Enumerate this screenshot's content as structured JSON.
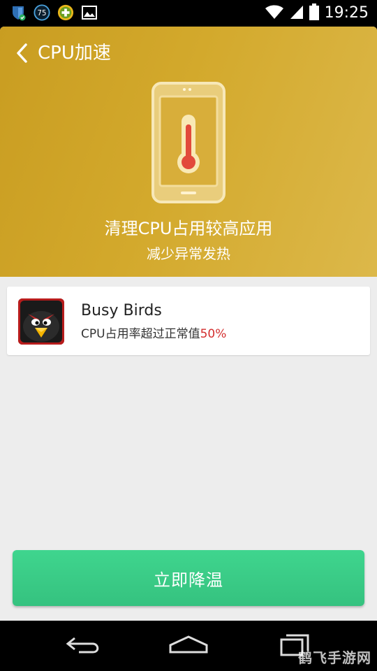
{
  "status_bar": {
    "notification_icons": [
      "shield-check-icon",
      "badge-75-icon",
      "game-controller-icon",
      "image-icon"
    ],
    "badge_number": "75",
    "time": "19:25"
  },
  "header": {
    "title": "CPU加速",
    "headline": "清理CPU占用较高应用",
    "subline": "减少异常发热"
  },
  "apps": [
    {
      "name": "Busy Birds",
      "desc_prefix": "CPU占用率超过正常值",
      "desc_value": "50%"
    }
  ],
  "action": {
    "label": "立即降温"
  },
  "watermark": {
    "text": "鹤飞手游网"
  },
  "colors": {
    "header_bg": "#d3a92c",
    "button_bg": "#3fd58e",
    "highlight_red": "#d32f2f",
    "page_bg": "#ededed"
  }
}
